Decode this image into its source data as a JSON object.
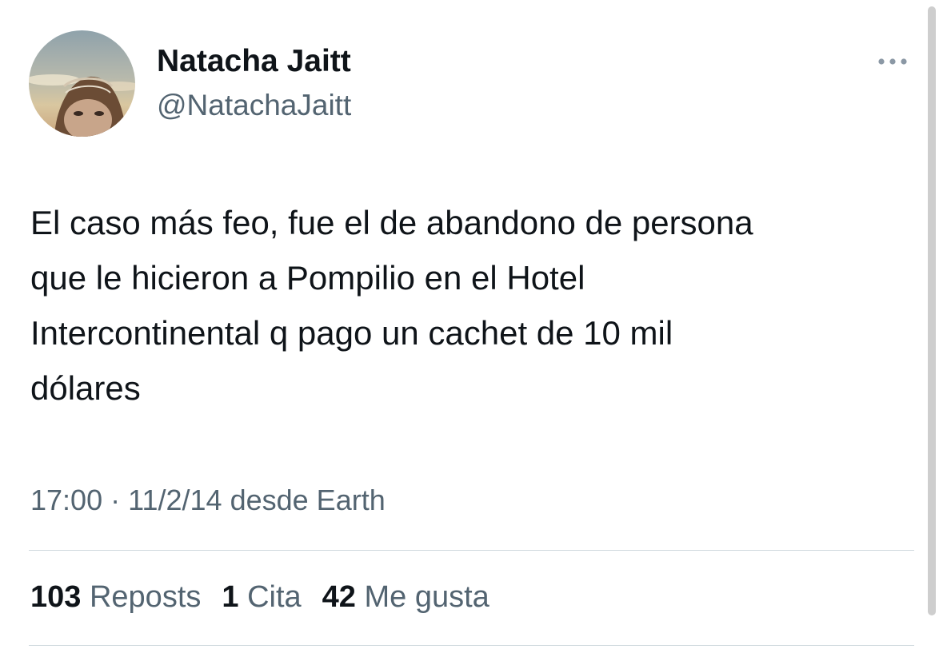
{
  "author": {
    "display_name": "Natacha Jaitt",
    "handle": "@NatachaJaitt",
    "avatar_icon": "profile-avatar"
  },
  "tweet": {
    "text": "El caso más feo, fue el de abandono de persona\nque le hicieron a Pompilio en el Hotel\nIntercontinental q pago un cachet de 10 mil\ndólares",
    "time": "17:00",
    "separator": "·",
    "date": "11/2/14",
    "source": "desde Earth"
  },
  "stats": {
    "reposts_count": "103",
    "reposts_label": "Reposts",
    "quotes_count": "1",
    "quotes_label": "Cita",
    "likes_count": "42",
    "likes_label": "Me gusta"
  },
  "colors": {
    "primary_text": "#0f1419",
    "secondary_text": "#536471",
    "divider": "#cfd9de"
  },
  "icons": {
    "more": "more-dots-icon"
  }
}
